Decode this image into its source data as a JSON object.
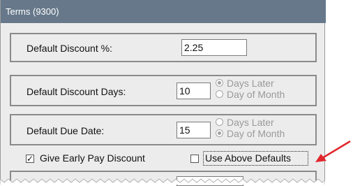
{
  "window": {
    "title": "Terms (9300)"
  },
  "discount_percent": {
    "label": "Default Discount %:",
    "value": "2.25"
  },
  "discount_days": {
    "label": "Default Discount Days:",
    "value": "10",
    "options": [
      {
        "label": "Days Later",
        "selected": true
      },
      {
        "label": "Day of Month",
        "selected": false
      }
    ]
  },
  "due_date": {
    "label": "Default Due Date:",
    "value": "15",
    "options": [
      {
        "label": "Days Later",
        "selected": false
      },
      {
        "label": "Day of Month",
        "selected": true
      }
    ]
  },
  "early_pay": {
    "label": "Give Early Pay Discount",
    "checked": true
  },
  "use_defaults": {
    "label": "Use Above Defaults",
    "checked": false
  },
  "annotation": {
    "arrow_color": "#e0282e"
  },
  "colors": {
    "title_bar": "#66788a",
    "panel_bg": "#ececec"
  }
}
